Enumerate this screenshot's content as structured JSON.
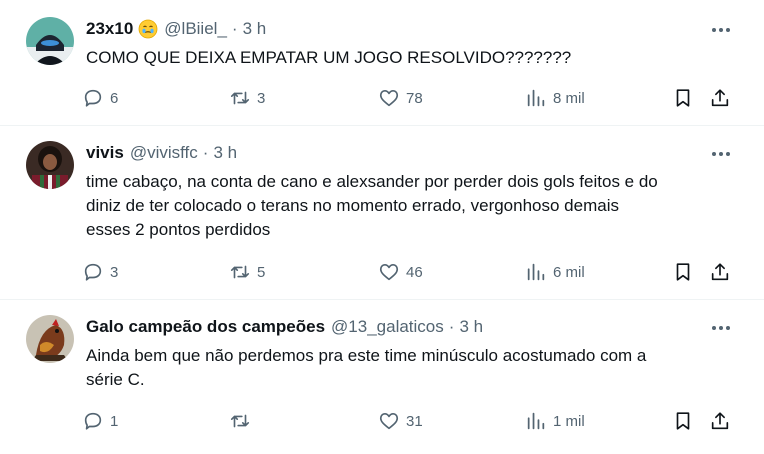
{
  "tweets": [
    {
      "display_name": "23x10",
      "emoji": "face-holding-back-tears",
      "handle": "@lBiiel_",
      "dot": "·",
      "time": "3 h",
      "text_lines": [
        "COMO QUE DEIXA EMPATAR UM JOGO RESOLVIDO???????"
      ],
      "replies": "6",
      "reposts": "3",
      "likes": "78",
      "views": "8 mil"
    },
    {
      "display_name": "vivis",
      "handle": "@vivisffc",
      "dot": "·",
      "time": "3 h",
      "text_lines": [
        "time cabaço, na conta de cano e alexsander por perder dois gols feitos e do",
        "diniz de ter colocado o terans no momento errado, vergonhoso demais",
        "esses 2 pontos perdidos"
      ],
      "replies": "3",
      "reposts": "5",
      "likes": "46",
      "views": "6 mil"
    },
    {
      "display_name": "Galo campeão dos campeões",
      "handle": "@13_galaticos",
      "dot": "·",
      "time": "3 h",
      "text_lines": [
        "Ainda bem que não perdemos pra este time minúsculo acostumado com a",
        "série C."
      ],
      "replies": "1",
      "reposts": "",
      "likes": "31",
      "views": "1 mil"
    }
  ],
  "colors": {
    "text": "#0f1419",
    "secondary": "#536471",
    "divider": "#eff3f4"
  },
  "icons": [
    "reply-icon",
    "repost-icon",
    "like-icon",
    "views-icon",
    "bookmark-icon",
    "share-icon",
    "more-icon"
  ]
}
